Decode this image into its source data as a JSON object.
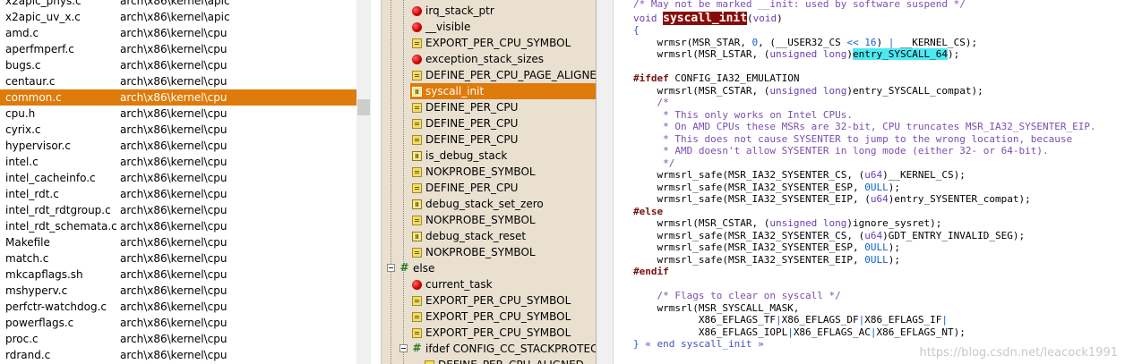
{
  "file_list": {
    "rows": [
      {
        "name": "x2apic_phys.c",
        "path": "arch\\x86\\kernel\\apic",
        "selected": false
      },
      {
        "name": "x2apic_uv_x.c",
        "path": "arch\\x86\\kernel\\apic",
        "selected": false
      },
      {
        "name": "amd.c",
        "path": "arch\\x86\\kernel\\cpu",
        "selected": false
      },
      {
        "name": "aperfmperf.c",
        "path": "arch\\x86\\kernel\\cpu",
        "selected": false
      },
      {
        "name": "bugs.c",
        "path": "arch\\x86\\kernel\\cpu",
        "selected": false
      },
      {
        "name": "centaur.c",
        "path": "arch\\x86\\kernel\\cpu",
        "selected": false
      },
      {
        "name": "common.c",
        "path": "arch\\x86\\kernel\\cpu",
        "selected": true
      },
      {
        "name": "cpu.h",
        "path": "arch\\x86\\kernel\\cpu",
        "selected": false
      },
      {
        "name": "cyrix.c",
        "path": "arch\\x86\\kernel\\cpu",
        "selected": false
      },
      {
        "name": "hypervisor.c",
        "path": "arch\\x86\\kernel\\cpu",
        "selected": false
      },
      {
        "name": "intel.c",
        "path": "arch\\x86\\kernel\\cpu",
        "selected": false
      },
      {
        "name": "intel_cacheinfo.c",
        "path": "arch\\x86\\kernel\\cpu",
        "selected": false
      },
      {
        "name": "intel_rdt.c",
        "path": "arch\\x86\\kernel\\cpu",
        "selected": false
      },
      {
        "name": "intel_rdt_rdtgroup.c",
        "path": "arch\\x86\\kernel\\cpu",
        "selected": false
      },
      {
        "name": "intel_rdt_schemata.c",
        "path": "arch\\x86\\kernel\\cpu",
        "selected": false
      },
      {
        "name": "Makefile",
        "path": "arch\\x86\\kernel\\cpu",
        "selected": false
      },
      {
        "name": "match.c",
        "path": "arch\\x86\\kernel\\cpu",
        "selected": false
      },
      {
        "name": "mkcapflags.sh",
        "path": "arch\\x86\\kernel\\cpu",
        "selected": false
      },
      {
        "name": "mshyperv.c",
        "path": "arch\\x86\\kernel\\cpu",
        "selected": false
      },
      {
        "name": "perfctr-watchdog.c",
        "path": "arch\\x86\\kernel\\cpu",
        "selected": false
      },
      {
        "name": "powerflags.c",
        "path": "arch\\x86\\kernel\\cpu",
        "selected": false
      },
      {
        "name": "proc.c",
        "path": "arch\\x86\\kernel\\cpu",
        "selected": false
      },
      {
        "name": "rdrand.c",
        "path": "arch\\x86\\kernel\\cpu",
        "selected": false
      }
    ]
  },
  "symbols": {
    "rows": [
      {
        "label": "irq_stack_ptr",
        "icon": "red-variable-icon",
        "level": 1
      },
      {
        "label": "__visible",
        "icon": "red-variable-icon",
        "level": 1
      },
      {
        "label": "EXPORT_PER_CPU_SYMBOL",
        "icon": "macro-icon",
        "level": 1
      },
      {
        "label": "exception_stack_sizes",
        "icon": "red-variable-icon",
        "level": 1
      },
      {
        "label": "DEFINE_PER_CPU_PAGE_ALIGNED",
        "icon": "macro-icon",
        "level": 1
      },
      {
        "label": "syscall_init",
        "icon": "function-icon",
        "level": 1,
        "selected": true
      },
      {
        "label": "DEFINE_PER_CPU",
        "icon": "macro-icon",
        "level": 1
      },
      {
        "label": "DEFINE_PER_CPU",
        "icon": "macro-icon",
        "level": 1
      },
      {
        "label": "DEFINE_PER_CPU",
        "icon": "macro-icon",
        "level": 1
      },
      {
        "label": "is_debug_stack",
        "icon": "function-icon",
        "level": 1
      },
      {
        "label": "NOKPROBE_SYMBOL",
        "icon": "macro-icon",
        "level": 1
      },
      {
        "label": "DEFINE_PER_CPU",
        "icon": "macro-icon",
        "level": 1
      },
      {
        "label": "debug_stack_set_zero",
        "icon": "function-icon",
        "level": 1
      },
      {
        "label": "NOKPROBE_SYMBOL",
        "icon": "macro-icon",
        "level": 1
      },
      {
        "label": "debug_stack_reset",
        "icon": "function-icon",
        "level": 1
      },
      {
        "label": "NOKPROBE_SYMBOL",
        "icon": "macro-icon",
        "level": 1
      },
      {
        "label": "else",
        "icon": "preprocessor-hash-icon",
        "level": 0,
        "expander": true
      },
      {
        "label": "current_task",
        "icon": "red-variable-icon",
        "level": 1
      },
      {
        "label": "EXPORT_PER_CPU_SYMBOL",
        "icon": "macro-icon",
        "level": 1
      },
      {
        "label": "EXPORT_PER_CPU_SYMBOL",
        "icon": "macro-icon",
        "level": 1
      },
      {
        "label": "EXPORT_PER_CPU_SYMBOL",
        "icon": "macro-icon",
        "level": 1
      },
      {
        "label": "ifdef CONFIG_CC_STACKPROTECT",
        "icon": "preprocessor-hash-icon",
        "level": 1,
        "expander": true
      },
      {
        "label": "DEFINE_PER_CPU_ALIGNED",
        "icon": "macro-icon",
        "level": 2
      }
    ]
  },
  "code": {
    "lines": [
      [
        {
          "t": "/* May not be marked __init: used by software suspend */",
          "c": "cm"
        }
      ],
      [
        {
          "t": "void ",
          "c": "kw"
        },
        {
          "t": "syscall_init",
          "c": "hl-def"
        },
        {
          "t": "(",
          "c": ""
        },
        {
          "t": "void",
          "c": "kw"
        },
        {
          "t": ")",
          "c": ""
        }
      ],
      [
        {
          "t": "{",
          "c": "op"
        }
      ],
      [
        {
          "t": "    wrmsr(MSR_STAR, ",
          "c": ""
        },
        {
          "t": "0",
          "c": "num"
        },
        {
          "t": ", (__USER32_CS ",
          "c": ""
        },
        {
          "t": "<<",
          "c": "op"
        },
        {
          "t": " ",
          "c": ""
        },
        {
          "t": "16",
          "c": "num"
        },
        {
          "t": ") ",
          "c": ""
        },
        {
          "t": "|",
          "c": "op"
        },
        {
          "t": " __KERNEL_CS);",
          "c": ""
        }
      ],
      [
        {
          "t": "    wrmsrl(MSR_LSTAR, (",
          "c": ""
        },
        {
          "t": "unsigned long",
          "c": "kw"
        },
        {
          "t": ")",
          "c": ""
        },
        {
          "t": "entry_SYSCALL_64",
          "c": "hl-ref"
        },
        {
          "t": ");",
          "c": ""
        }
      ],
      [
        {
          "t": "",
          "c": ""
        }
      ],
      [
        {
          "t": "#ifdef",
          "c": "pp"
        },
        {
          "t": " CONFIG_IA32_EMULATION",
          "c": ""
        }
      ],
      [
        {
          "t": "    wrmsrl(MSR_CSTAR, (",
          "c": ""
        },
        {
          "t": "unsigned long",
          "c": "kw"
        },
        {
          "t": ")entry_SYSCALL_compat);",
          "c": ""
        }
      ],
      [
        {
          "t": "    /*",
          "c": "cm"
        }
      ],
      [
        {
          "t": "     * This only works on Intel CPUs.",
          "c": "cm"
        }
      ],
      [
        {
          "t": "     * On AMD CPUs these MSRs are 32-bit, CPU truncates MSR_IA32_SYSENTER_EIP.",
          "c": "cm"
        }
      ],
      [
        {
          "t": "     * This does not cause SYSENTER to jump to the wrong location, because",
          "c": "cm"
        }
      ],
      [
        {
          "t": "     * AMD doesn't allow SYSENTER in long mode (either 32- or 64-bit).",
          "c": "cm"
        }
      ],
      [
        {
          "t": "     */",
          "c": "cm"
        }
      ],
      [
        {
          "t": "    wrmsrl_safe(MSR_IA32_SYSENTER_CS, (",
          "c": ""
        },
        {
          "t": "u64",
          "c": "kw"
        },
        {
          "t": ")__KERNEL_CS);",
          "c": ""
        }
      ],
      [
        {
          "t": "    wrmsrl_safe(MSR_IA32_SYSENTER_ESP, ",
          "c": ""
        },
        {
          "t": "0ULL",
          "c": "lit"
        },
        {
          "t": ");",
          "c": ""
        }
      ],
      [
        {
          "t": "    wrmsrl_safe(MSR_IA32_SYSENTER_EIP, (",
          "c": ""
        },
        {
          "t": "u64",
          "c": "kw"
        },
        {
          "t": ")entry_SYSENTER_compat);",
          "c": ""
        }
      ],
      [
        {
          "t": "#else",
          "c": "pp"
        }
      ],
      [
        {
          "t": "    wrmsrl(MSR_CSTAR, (",
          "c": ""
        },
        {
          "t": "unsigned long",
          "c": "kw"
        },
        {
          "t": ")ignore_sysret);",
          "c": ""
        }
      ],
      [
        {
          "t": "    wrmsrl_safe(MSR_IA32_SYSENTER_CS, (",
          "c": ""
        },
        {
          "t": "u64",
          "c": "kw"
        },
        {
          "t": ")GDT_ENTRY_INVALID_SEG);",
          "c": ""
        }
      ],
      [
        {
          "t": "    wrmsrl_safe(MSR_IA32_SYSENTER_ESP, ",
          "c": ""
        },
        {
          "t": "0ULL",
          "c": "lit"
        },
        {
          "t": ");",
          "c": ""
        }
      ],
      [
        {
          "t": "    wrmsrl_safe(MSR_IA32_SYSENTER_EIP, ",
          "c": ""
        },
        {
          "t": "0ULL",
          "c": "lit"
        },
        {
          "t": ");",
          "c": ""
        }
      ],
      [
        {
          "t": "#endif",
          "c": "pp"
        }
      ],
      [
        {
          "t": "",
          "c": ""
        }
      ],
      [
        {
          "t": "    /* Flags to clear on syscall */",
          "c": "cm"
        }
      ],
      [
        {
          "t": "    wrmsrl(MSR_SYSCALL_MASK,",
          "c": ""
        }
      ],
      [
        {
          "t": "           X86_EFLAGS_TF",
          "c": ""
        },
        {
          "t": "|",
          "c": "op"
        },
        {
          "t": "X86_EFLAGS_DF",
          "c": ""
        },
        {
          "t": "|",
          "c": "op"
        },
        {
          "t": "X86_EFLAGS_IF",
          "c": ""
        },
        {
          "t": "|",
          "c": "op"
        }
      ],
      [
        {
          "t": "           X86_EFLAGS_IOPL",
          "c": ""
        },
        {
          "t": "|",
          "c": "op"
        },
        {
          "t": "X86_EFLAGS_AC",
          "c": ""
        },
        {
          "t": "|",
          "c": "op"
        },
        {
          "t": "X86_EFLAGS_NT);",
          "c": ""
        }
      ],
      [
        {
          "t": "} ",
          "c": "op"
        },
        {
          "t": "« end syscall_init »",
          "c": "end"
        }
      ]
    ],
    "watermark": "https://blog.csdn.net/leacock1991"
  },
  "colors": {
    "selection": "#de7b0a",
    "symbol_pane_bg": "#e9e0d0",
    "definition_highlight": "#8a0a0a",
    "reference_highlight": "#4ce9f2"
  }
}
